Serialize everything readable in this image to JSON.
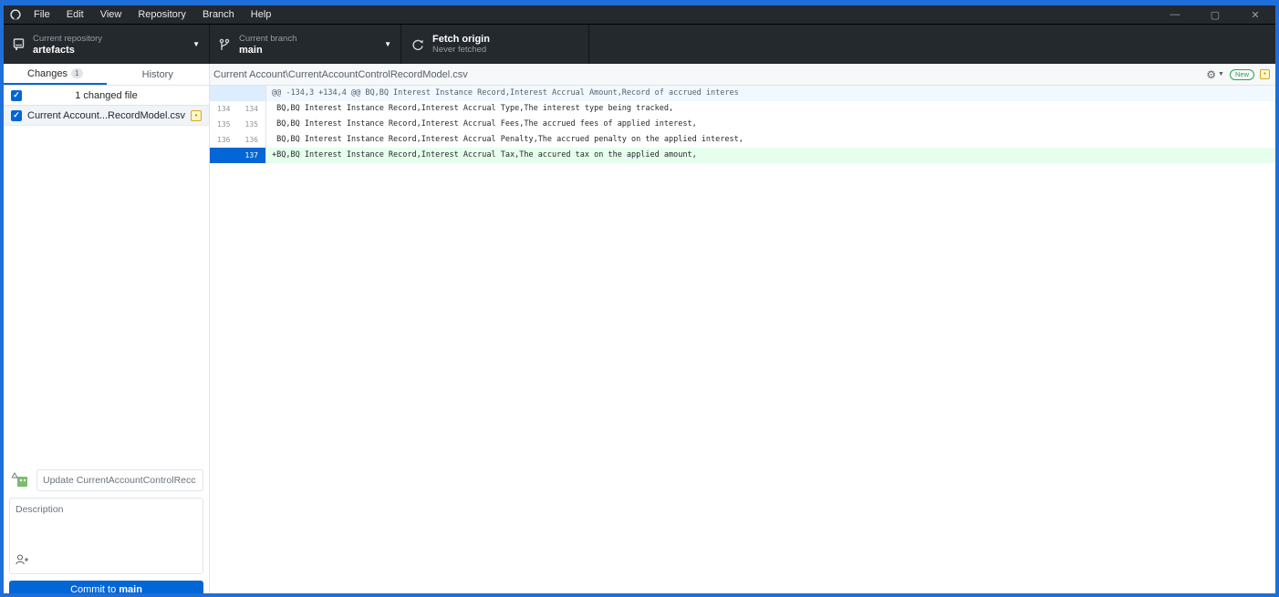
{
  "menu": {
    "items": [
      "File",
      "Edit",
      "View",
      "Repository",
      "Branch",
      "Help"
    ],
    "win_minimize": "—",
    "win_restore": "▢",
    "win_close": "✕"
  },
  "toolbar": {
    "repo_caption": "Current repository",
    "repo_value": "artefacts",
    "branch_caption": "Current branch",
    "branch_value": "main",
    "fetch_title": "Fetch origin",
    "fetch_sub": "Never fetched"
  },
  "sidebar": {
    "tab_changes": "Changes",
    "tab_changes_count": "1",
    "tab_history": "History",
    "changes_count_label": "1 changed file",
    "files": [
      {
        "name": "Current Account...RecordModel.csv",
        "status": "•"
      }
    ]
  },
  "commit": {
    "summary_placeholder": "Update CurrentAccountControlRecc",
    "description_placeholder": "Description",
    "button_prefix": "Commit to",
    "button_branch": "main"
  },
  "diff": {
    "path": "Current Account\\CurrentAccountControlRecordModel.csv",
    "new_label": "New",
    "hunk": "@@ -134,3 +134,4 @@ BQ,BQ Interest Instance Record,Interest Accrual Amount,Record of accrued interes",
    "lines": [
      {
        "old": "134",
        "new": "134",
        "text": " BQ,BQ Interest Instance Record,Interest Accrual Type,The interest type being tracked,"
      },
      {
        "old": "135",
        "new": "135",
        "text": " BQ,BQ Interest Instance Record,Interest Accrual Fees,The accrued fees of applied interest,"
      },
      {
        "old": "136",
        "new": "136",
        "text": " BQ,BQ Interest Instance Record,Interest Accrual Penalty,The accrued penalty on the applied interest,"
      },
      {
        "old": "",
        "new": "137",
        "text": "+BQ,BQ Interest Instance Record,Interest Accrual Tax,The accured tax on the applied amount,"
      }
    ]
  },
  "colors": {
    "accent": "#0366d6",
    "toolbar_bg": "#24292e",
    "added_bg": "#e6ffed",
    "frame": "#1e6fd9"
  }
}
